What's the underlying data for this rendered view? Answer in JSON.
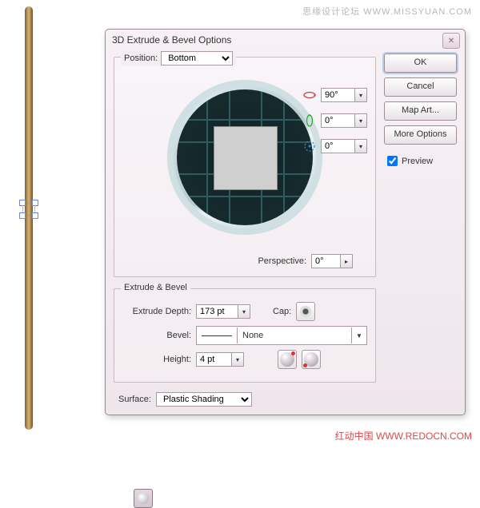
{
  "watermark_top": "思缘设计论坛  WWW.MISSYUAN.COM",
  "watermark_bottom": "红动中国  WWW.REDOCN.COM",
  "dialog": {
    "title": "3D Extrude & Bevel Options",
    "close": "✕",
    "buttons": {
      "ok": "OK",
      "cancel": "Cancel",
      "map": "Map Art...",
      "more": "More Options"
    },
    "preview_label": "Preview",
    "position": {
      "label": "Position:",
      "value": "Bottom",
      "axis_x": "90°",
      "axis_y": "0°",
      "axis_z": "0°",
      "perspective_label": "Perspective:",
      "perspective_value": "0°"
    },
    "extrude": {
      "legend": "Extrude & Bevel",
      "depth_label": "Extrude Depth:",
      "depth_value": "173 pt",
      "cap_label": "Cap:",
      "bevel_label": "Bevel:",
      "bevel_value": "None",
      "height_label": "Height:",
      "height_value": "4 pt"
    },
    "surface": {
      "label": "Surface:",
      "value": "Plastic Shading"
    }
  }
}
